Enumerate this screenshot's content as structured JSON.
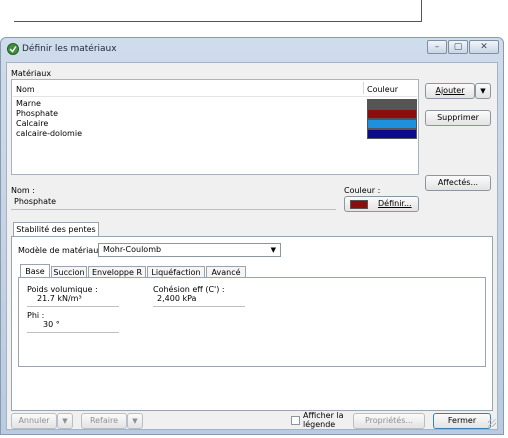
{
  "window": {
    "title": "Définir les matériaux",
    "minimize": "–",
    "maximize": "▢",
    "close": "✕"
  },
  "materials": {
    "group_label": "Matériaux",
    "col_name": "Nom",
    "col_color": "Couleur",
    "rows": [
      {
        "name": "Marne",
        "color": "#555555"
      },
      {
        "name": "Phosphate",
        "color": "#8b0d0d"
      },
      {
        "name": "Calcaire",
        "color": "#1e90e0"
      },
      {
        "name": "calcaire-dolomie",
        "color": "#0b0b8c"
      }
    ]
  },
  "side_buttons": {
    "add": "Ajouter",
    "add_arrow": "▼",
    "delete": "Supprimer",
    "assigned": "Affectés..."
  },
  "name_field": {
    "label": "Nom :",
    "value": "Phosphate"
  },
  "color_field": {
    "label": "Couleur :",
    "swatch": "#8b0d0d",
    "define": "Définir..."
  },
  "outer_tab": {
    "label": "Stabilité des pentes"
  },
  "model": {
    "label": "Modèle de matériau :",
    "value": "Mohr-Coulomb",
    "arrow": "▼"
  },
  "inner_tabs": [
    "Base",
    "Succion",
    "Enveloppe R",
    "Liquéfaction",
    "Avancé"
  ],
  "base": {
    "unit_weight_label": "Poids volumique :",
    "unit_weight_value": "21.7 kN/m³",
    "cohesion_label": "Cohésion eff (C') :",
    "cohesion_value": "2,400 kPa",
    "phi_label": "Phi :",
    "phi_value": "30 °"
  },
  "footer": {
    "cancel": "Annuler",
    "redo": "Refaire",
    "arrow": "▼",
    "legend_line1": "Afficher la",
    "legend_line2": "légende",
    "properties": "Propriétés...",
    "close": "Fermer"
  }
}
